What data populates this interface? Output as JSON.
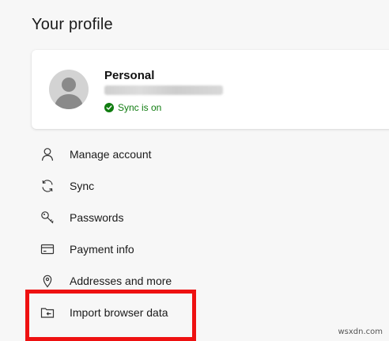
{
  "page": {
    "title": "Your profile"
  },
  "profile": {
    "name": "Personal",
    "email": "",
    "sync_status": "Sync is on"
  },
  "menu": {
    "items": [
      {
        "label": "Manage account",
        "icon": "person-icon"
      },
      {
        "label": "Sync",
        "icon": "sync-icon"
      },
      {
        "label": "Passwords",
        "icon": "key-icon"
      },
      {
        "label": "Payment info",
        "icon": "credit-card-icon"
      },
      {
        "label": "Addresses and more",
        "icon": "location-pin-icon"
      },
      {
        "label": "Import browser data",
        "icon": "folder-import-icon"
      }
    ]
  },
  "highlight": {
    "color": "#ee1111",
    "target": "Import browser data"
  },
  "colors": {
    "background": "#f7f7f7",
    "card": "#ffffff",
    "sync_green": "#107c10"
  },
  "watermark": "wsxdn.com"
}
